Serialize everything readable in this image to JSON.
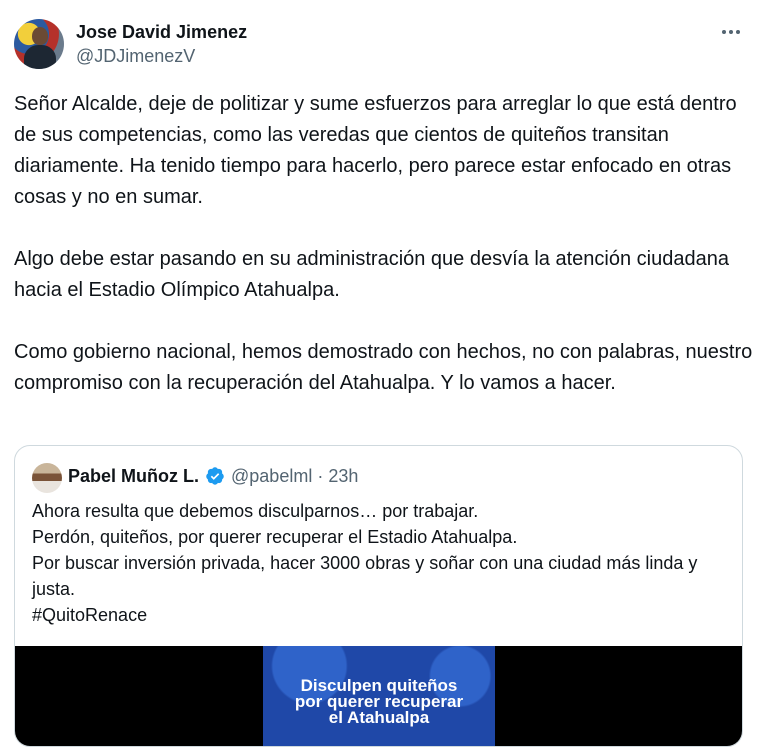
{
  "author": {
    "name": "Jose David Jimenez",
    "handle": "@JDJimenezV"
  },
  "menu": {
    "icon": "more-horizontal-icon"
  },
  "tweet": {
    "paragraphs": [
      "Señor Alcalde, deje de politizar y sume esfuerzos para arreglar lo que está dentro de sus competencias, como las veredas que cientos de quiteños transitan diariamente. Ha tenido tiempo para hacerlo, pero parece estar enfocado en otras cosas y no en sumar.",
      "Algo debe estar pasando en su administración que desvía la atención ciudadana hacia el Estadio Olímpico Atahualpa.",
      "Como gobierno nacional, hemos demostrado con hechos, no con palabras, nuestro compromiso con la recuperación del Atahualpa. Y lo vamos a hacer."
    ]
  },
  "quote": {
    "name": "Pabel Muñoz L.",
    "verified_icon": "verified-badge-icon",
    "verified_color": "#1d9bf0",
    "handle": "@pabelml",
    "separator": "·",
    "time": "23h",
    "lines": [
      "Ahora resulta que debemos disculparnos… por trabajar.",
      "Perdón, quiteños, por querer recuperar el Estadio Atahualpa.",
      "Por buscar inversión privada, hacer 3000 obras y soñar con una ciudad más linda y justa.",
      "#QuitoRenace"
    ],
    "media_caption": [
      "Disculpen quiteños",
      "por querer recuperar",
      "el Atahualpa"
    ]
  }
}
